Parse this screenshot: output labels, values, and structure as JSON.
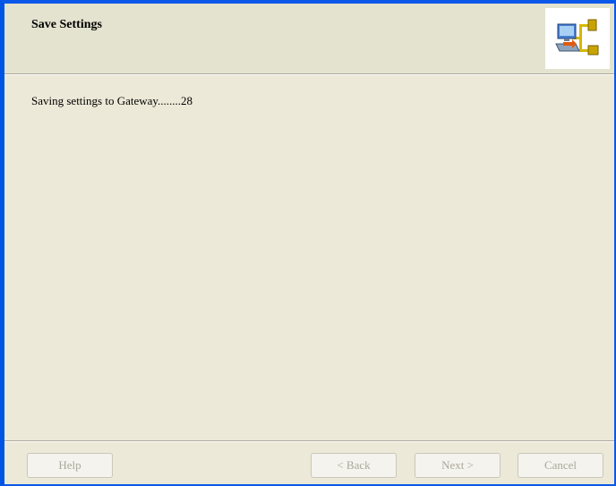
{
  "header": {
    "title": "Save Settings",
    "icon": "network-computers-icon"
  },
  "main": {
    "status_text": "Saving settings to Gateway........28"
  },
  "footer": {
    "help_label": "Help",
    "back_label": "< Back",
    "next_label": "Next >",
    "cancel_label": "Cancel"
  },
  "colors": {
    "window_border": "#0054e3",
    "background": "#ece9d8",
    "header_background": "#e4e3d0",
    "disabled_text": "#aca899"
  }
}
